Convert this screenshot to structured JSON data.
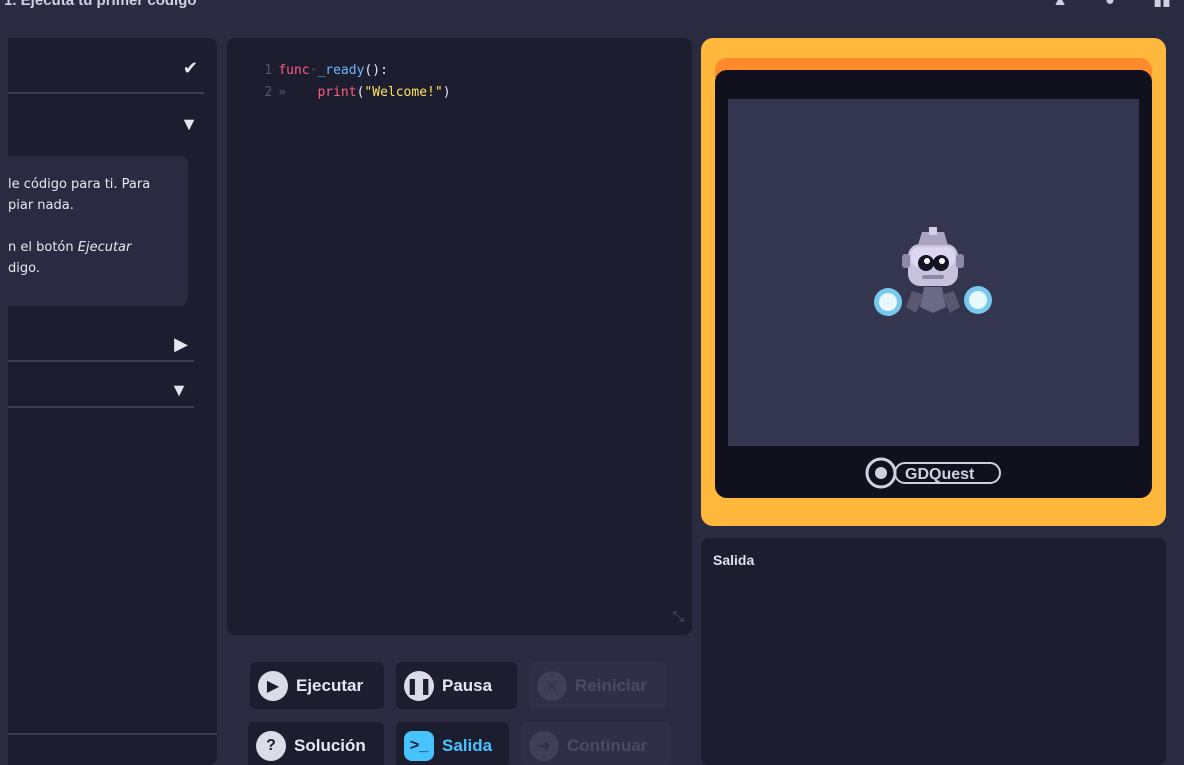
{
  "topbar": {
    "title": "1. Ejecuta tu primer código"
  },
  "left_panel": {
    "card_lines": [
      "le código para ti. Para",
      "piar nada.",
      "n el botón ",
      "digo."
    ],
    "card_emphasis": "Ejecutar"
  },
  "editor": {
    "lines": [
      {
        "num": "1",
        "keyword": "func",
        "ws": "·",
        "name": "_ready",
        "rest": "():"
      },
      {
        "num": "2",
        "indent": "»    ",
        "call": "print",
        "open": "(",
        "string": "\"Welcome!\"",
        "close": ")"
      }
    ]
  },
  "buttons": {
    "run": "Ejecutar",
    "pause": "Pausa",
    "restart": "Reiniciar",
    "solution": "Solución",
    "output": "Salida",
    "continue": "Continuar"
  },
  "preview": {
    "logo_text": "GDQuest"
  },
  "output_panel": {
    "label": "Salida"
  },
  "colors": {
    "preview_border": "#ffb83b",
    "accent": "#47c3ff"
  }
}
